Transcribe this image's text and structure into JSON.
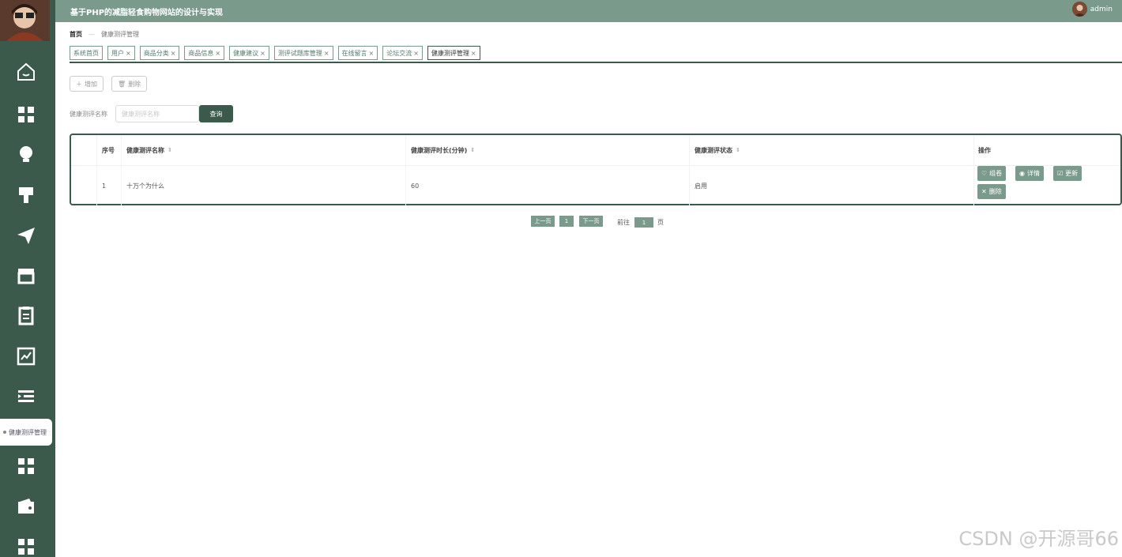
{
  "app": {
    "title": "基于PHP的减脂轻食购物网站的设计与实现",
    "username": "admin"
  },
  "sidebar": {
    "icons": [
      "home-icon",
      "grid-icon",
      "bulb-icon",
      "brush-icon",
      "send-icon",
      "store-icon",
      "clipboard-icon",
      "chart-icon",
      "list-indent-icon",
      "grid-icon",
      "wallet-icon",
      "grid-icon"
    ],
    "active_label": "健康测评管理"
  },
  "breadcrumb": {
    "home": "首页",
    "separator": "—",
    "current": "健康测评管理"
  },
  "tabs": [
    {
      "label": "系统首页",
      "closable": false
    },
    {
      "label": "用户",
      "closable": true
    },
    {
      "label": "商品分类",
      "closable": true
    },
    {
      "label": "商品信息",
      "closable": true
    },
    {
      "label": "健康建议",
      "closable": true
    },
    {
      "label": "测评试题库管理",
      "closable": true
    },
    {
      "label": "在线留言",
      "closable": true
    },
    {
      "label": "论坛交流",
      "closable": true
    },
    {
      "label": "健康测评管理",
      "closable": true,
      "active": true
    }
  ],
  "toolbar": {
    "add_label": "增加",
    "delete_label": "删除"
  },
  "search": {
    "label": "健康测评名称",
    "placeholder": "健康测评名称",
    "value": "",
    "button_label": "查询"
  },
  "table": {
    "headers": {
      "index": "序号",
      "name": "健康测评名称",
      "duration": "健康测评时长(分钟)",
      "status": "健康测评状态",
      "actions": "操作"
    },
    "rows": [
      {
        "index": "1",
        "name": "十万个为什么",
        "duration": "60",
        "status": "启用"
      }
    ],
    "actions": {
      "compose": "组卷",
      "detail": "详情",
      "update": "更新",
      "delete": "删除"
    }
  },
  "pagination": {
    "prev": "上一页",
    "page": "1",
    "next": "下一页",
    "goto_prefix": "前往",
    "goto_value": "1",
    "goto_suffix": "页"
  },
  "watermark": "CSDN @开源哥66",
  "colors": {
    "sidebar": "#3b5a4c",
    "topbar": "#7a9a8c",
    "accent": "#7a9a8c",
    "primary_dark": "#3b5a4c"
  }
}
